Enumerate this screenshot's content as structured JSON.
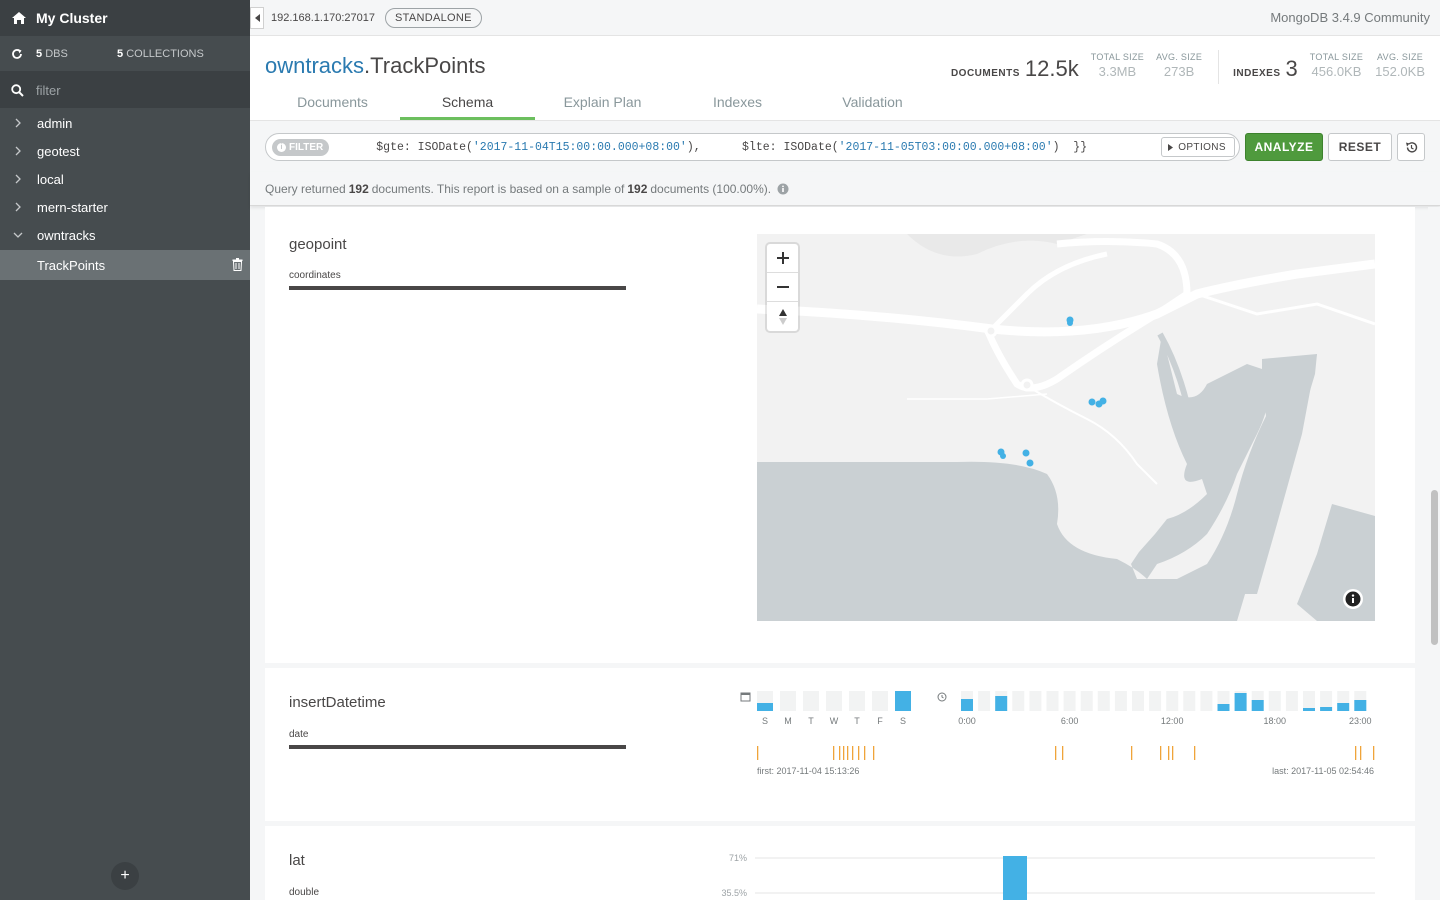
{
  "sidebar": {
    "title": "My Cluster",
    "dbs_count": "5",
    "dbs_label": "DBS",
    "collections_count": "5",
    "collections_label": "COLLECTIONS",
    "filter_placeholder": "filter",
    "databases": [
      "admin",
      "geotest",
      "local",
      "mern-starter",
      "owntracks"
    ],
    "active_collection": "TrackPoints",
    "add_label": "+"
  },
  "topbar": {
    "host": "192.168.1.170:27017",
    "badge": "STANDALONE",
    "version": "MongoDB 3.4.9 Community"
  },
  "header": {
    "db": "owntracks",
    "sep": ".",
    "collection": "TrackPoints",
    "documents_label": "DOCUMENTS",
    "documents_value": "12.5k",
    "doc_total_size_label": "TOTAL SIZE",
    "doc_total_size": "3.3MB",
    "doc_avg_size_label": "AVG. SIZE",
    "doc_avg_size": "273B",
    "indexes_label": "INDEXES",
    "indexes_value": "3",
    "idx_total_size_label": "TOTAL SIZE",
    "idx_total_size": "456.0KB",
    "idx_avg_size_label": "AVG. SIZE",
    "idx_avg_size": "152.0KB",
    "tabs": [
      "Documents",
      "Schema",
      "Explain Plan",
      "Indexes",
      "Validation"
    ],
    "active_tab": "Schema"
  },
  "query": {
    "filter_label": "FILTER",
    "q1": "$gte: ISODate(",
    "q2": "'2017-11-04T15:00:00.000+08:00'",
    "q3": "),      $lte: ISODate(",
    "q4": "'2017-11-05T03:00:00.000+08:00'",
    "q5": ")  }}",
    "options_label": "OPTIONS",
    "analyze_label": "ANALYZE",
    "reset_label": "RESET"
  },
  "summary": {
    "prefix": "Query returned",
    "returned": "192",
    "middle": "documents. This report is based on a sample of",
    "sampled": "192",
    "suffix": "documents (100.00%)."
  },
  "fields": [
    {
      "name": "geopoint",
      "type": "coordinates"
    },
    {
      "name": "insertDatetime",
      "type": "date"
    },
    {
      "name": "lat",
      "type": "double"
    }
  ],
  "date_chart": {
    "days": [
      "S",
      "M",
      "T",
      "W",
      "T",
      "F",
      "S"
    ],
    "day_values": [
      0.4,
      0,
      0,
      0,
      0,
      0,
      1.0
    ],
    "hour_labels": [
      "0:00",
      "6:00",
      "12:00",
      "18:00",
      "23:00"
    ],
    "hour_values": [
      0.6,
      0,
      0.75,
      0,
      0,
      0,
      0,
      0,
      0,
      0,
      0,
      0,
      0,
      0,
      0,
      0.35,
      0.9,
      0.55,
      0,
      0,
      0.15,
      0.2,
      0.4,
      0.55
    ],
    "first": "first: 2017-11-04 15:13:26",
    "last": "last: 2017-11-05 02:54:46"
  },
  "lat_chart": {
    "y_labels": [
      "71%",
      "35.5%"
    ]
  },
  "colors": {
    "accent_green": "#4f9a3d",
    "link_blue": "#2a7ab0",
    "bar_blue": "#43b1e5",
    "tick_orange": "#f0a43a"
  }
}
